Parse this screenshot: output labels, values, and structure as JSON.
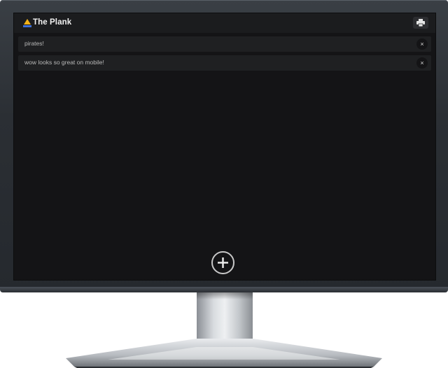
{
  "app": {
    "title": "The Plank",
    "logo_icon": "sailboat-icon",
    "print_icon": "printer-icon"
  },
  "notes": [
    {
      "text": "pirates!",
      "delete_label": "×"
    },
    {
      "text": "wow looks so great on mobile!",
      "delete_label": "×"
    }
  ],
  "add_button": {
    "icon": "plus-icon"
  },
  "colors": {
    "background": "#141416",
    "header": "#1b1c1e",
    "note": "#1f2022",
    "logo_accent": "#f2b21a",
    "bezel": "#2b2f34"
  }
}
